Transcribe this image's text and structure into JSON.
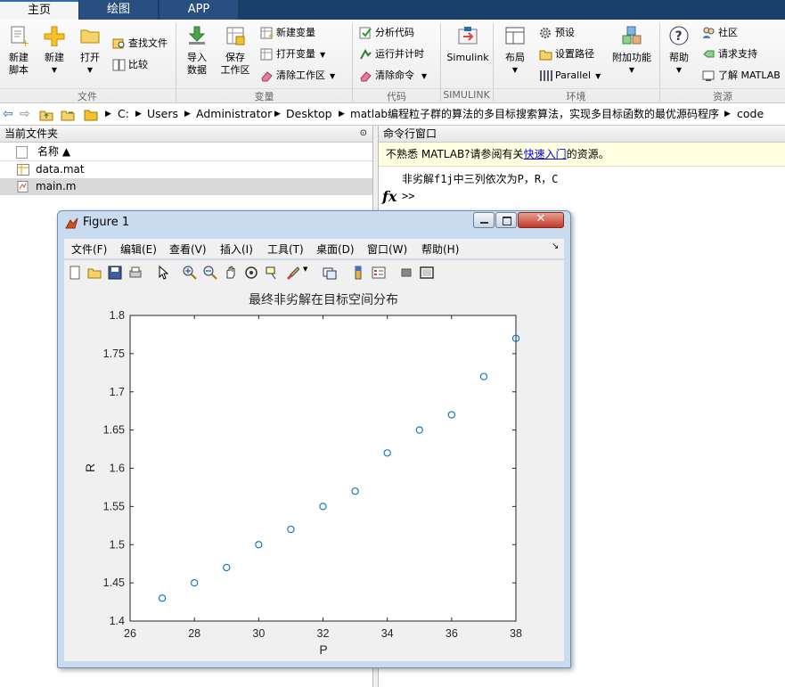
{
  "tabs": {
    "home": "主页",
    "plots": "绘图",
    "apps": "APP"
  },
  "toolstrip": {
    "file": {
      "new_script": "新建\n脚本",
      "new": "新建",
      "open": "打开",
      "find_files": "查找文件",
      "compare": "比较",
      "label": "文件"
    },
    "variable": {
      "import": "导入\n数据",
      "save_ws": "保存\n工作区",
      "new_var": "新建变量",
      "open_var": "打开变量",
      "clear_ws": "清除工作区",
      "label": "变量"
    },
    "code": {
      "analyze": "分析代码",
      "run_time": "运行并计时",
      "clear_cmd": "清除命令",
      "label": "代码"
    },
    "simulink": {
      "btn": "Simulink",
      "label": "SIMULINK"
    },
    "environment": {
      "layout": "布局",
      "prefs": "预设",
      "set_path": "设置路径",
      "parallel": "Parallel",
      "addons": "附加功能",
      "label": "环境"
    },
    "resources": {
      "help": "帮助",
      "community": "社区",
      "support": "请求支持",
      "learn": "了解 MATLAB",
      "label": "资源"
    }
  },
  "address": [
    "C:",
    "Users",
    "Administrator",
    "Desktop",
    "matlab编程粒子群的算法的多目标搜索算法，实现多目标函数的最优源码程序",
    "code"
  ],
  "current_folder": {
    "title": "当前文件夹",
    "column_name": "名称 ▲",
    "files": [
      {
        "name": "data.mat"
      },
      {
        "name": "main.m"
      }
    ]
  },
  "command_window": {
    "title": "命令行窗口",
    "notice_pre": "不熟悉 MATLAB?请参阅有关",
    "notice_link": "快速入门",
    "notice_post": "的资源。",
    "output": "非劣解f1j中三列依次为P，R，C",
    "prompt": ">>"
  },
  "figure": {
    "title": "Figure 1",
    "menus": [
      "文件(F)",
      "编辑(E)",
      "查看(V)",
      "插入(I)",
      "工具(T)",
      "桌面(D)",
      "窗口(W)",
      "帮助(H)"
    ]
  },
  "chart_data": {
    "type": "scatter",
    "title": "最终非劣解在目标空间分布",
    "xlabel": "P",
    "ylabel": "R",
    "xlim": [
      26,
      38
    ],
    "ylim": [
      1.4,
      1.8
    ],
    "xticks": [
      "26",
      "28",
      "30",
      "32",
      "34",
      "36",
      "38"
    ],
    "yticks": [
      "1.4",
      "1.45",
      "1.5",
      "1.55",
      "1.6",
      "1.65",
      "1.7",
      "1.75",
      "1.8"
    ],
    "marker": "circle",
    "color": "#0072bd",
    "grid": false,
    "x": [
      27,
      28,
      29,
      30,
      31,
      32,
      33,
      34,
      35,
      36,
      37,
      38
    ],
    "y": [
      1.43,
      1.45,
      1.47,
      1.5,
      1.52,
      1.55,
      1.57,
      1.62,
      1.65,
      1.67,
      1.72,
      1.77
    ]
  }
}
